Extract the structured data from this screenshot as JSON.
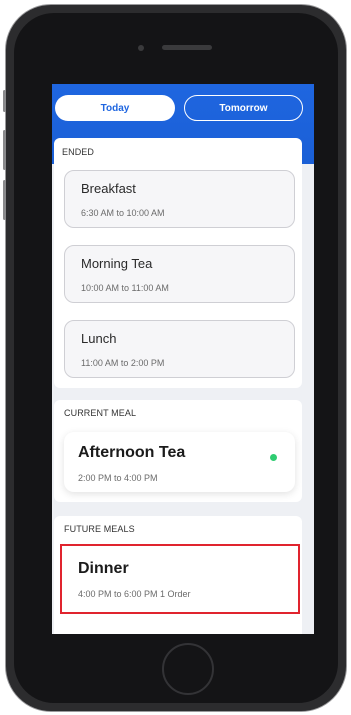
{
  "tabs": {
    "today": "Today",
    "tomorrow": "Tomorrow",
    "selected": "Today"
  },
  "ended": {
    "label": "ENDED",
    "meals": [
      {
        "name": "Breakfast",
        "time": "6:30 AM to 10:00 AM"
      },
      {
        "name": "Morning Tea",
        "time": "10:00 AM to 11:00 AM"
      },
      {
        "name": "Lunch",
        "time": "11:00 AM to 2:00 PM"
      }
    ]
  },
  "current": {
    "label": "CURRENT MEAL",
    "meal": {
      "name": "Afternoon Tea",
      "time": "2:00 PM to 4:00 PM",
      "status_color": "#2ecc71"
    }
  },
  "future": {
    "label": "FUTURE MEALS",
    "meal": {
      "name": "Dinner",
      "time": "4:00 PM to 6:00 PM 1 Order"
    }
  },
  "colors": {
    "accent": "#1f66e0",
    "highlight": "#e0242e",
    "active": "#2ecc71"
  }
}
